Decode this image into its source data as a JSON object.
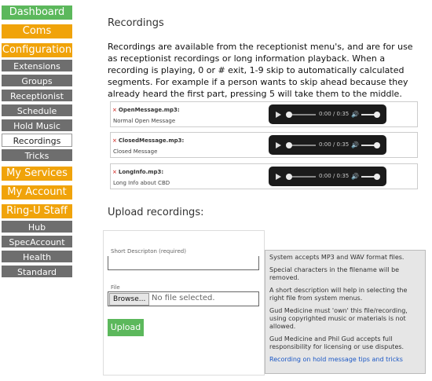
{
  "nav": {
    "dashboard": "Dashboard",
    "coms": "Coms",
    "configuration": "Configuration",
    "config_items": [
      "Extensions",
      "Groups",
      "Receptionist",
      "Schedule",
      "Hold Music",
      "Recordings",
      "Tricks"
    ],
    "my_services": "My Services",
    "my_account": "My Account",
    "staff": "Ring-U Staff",
    "staff_items": [
      "Hub",
      "SpecAccount",
      "Health",
      "Standard"
    ]
  },
  "page": {
    "title": "Recordings",
    "intro": "Recordings are available from the receptionist menu's, and are for use as receptionist recordings or long information playback. When a recording is playing, 0 or # exit, 1-9 skip to automatically calculated segments. For example if a person wants to skip ahead because they already heard the first part, pressing 5 will take them to the middle."
  },
  "recordings": [
    {
      "delete": "×",
      "name": "OpenMessage.mp3:",
      "desc": "Normal Open Message",
      "time": "0:00 / 0:35"
    },
    {
      "delete": "×",
      "name": "ClosedMessage.mp3:",
      "desc": "Closed Message",
      "time": "0:00 / 0:35"
    },
    {
      "delete": "×",
      "name": "LongInfo.mp3:",
      "desc": "Long Info about CBD",
      "time": "0:00 / 0:35"
    }
  ],
  "upload": {
    "heading": "Upload recordings:",
    "short_label": "Short Descripton (required)",
    "file_label": "File",
    "browse": "Browse...",
    "no_file": "No file selected.",
    "button": "Upload"
  },
  "info": {
    "p1": "System accepts MP3 and WAV format files.",
    "p2": "Special characters in the filename will be removed.",
    "p3": "A short description will help in selecting the right file from system menus.",
    "p4": "Gud Medicine must 'own' this file/recording, using copyrighted music or materials is not allowed.",
    "p5": "Gud Medicine and Phil Gud accepts full responsibility for licensing or use disputes.",
    "link": "Recording on hold message tips and tricks"
  },
  "colors": {
    "green": "#5cb85c",
    "orange": "#f0a30a",
    "grey": "#6e6e6e"
  }
}
